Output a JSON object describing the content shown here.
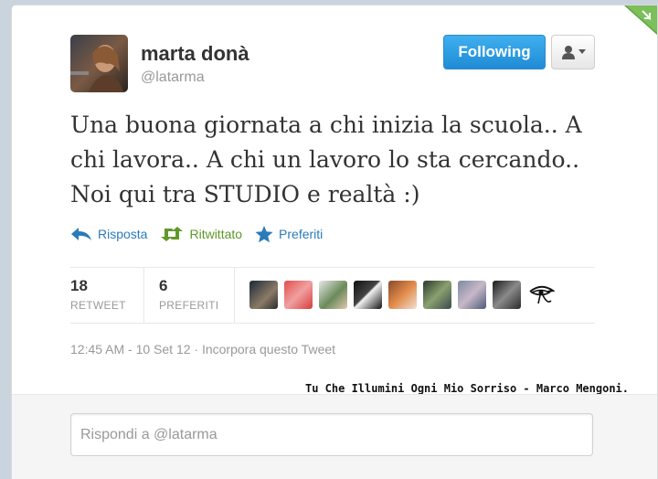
{
  "tweet": {
    "author_name": "marta donà",
    "author_handle": "@latarma",
    "text_lines": [
      "Una buona giornata a chi inizia la scuola.. A",
      "chi lavora.. A chi un lavoro lo sta cercando..",
      "Noi qui tra STUDIO e realtà :)"
    ],
    "timestamp": "12:45 AM - 10 Set 12 · Incorpora questo Tweet"
  },
  "follow_button": {
    "label": "Following",
    "color": "#1f8bd5"
  },
  "user_menu_button": {
    "icon": "user-dropdown-icon"
  },
  "actions": {
    "reply": {
      "label": "Risposta",
      "icon": "reply-icon"
    },
    "retweet": {
      "label": "Ritwittato",
      "icon": "retweet-icon"
    },
    "favorite": {
      "label": "Preferiti",
      "icon": "star-icon"
    }
  },
  "stats": {
    "retweets": {
      "count": "18",
      "label": "RETWEET"
    },
    "favorites": {
      "count": "6",
      "label": "PREFERITI"
    }
  },
  "signature": "Tu Che Illumini Ogni Mio Sorriso - Marco Mengoni.",
  "reply": {
    "placeholder": "Rispondi a @latarma"
  },
  "colors": {
    "link_blue": "#2b7bb9",
    "retweet_green": "#609928",
    "muted_gray": "#999999",
    "corner_green": "#5ca23c"
  }
}
